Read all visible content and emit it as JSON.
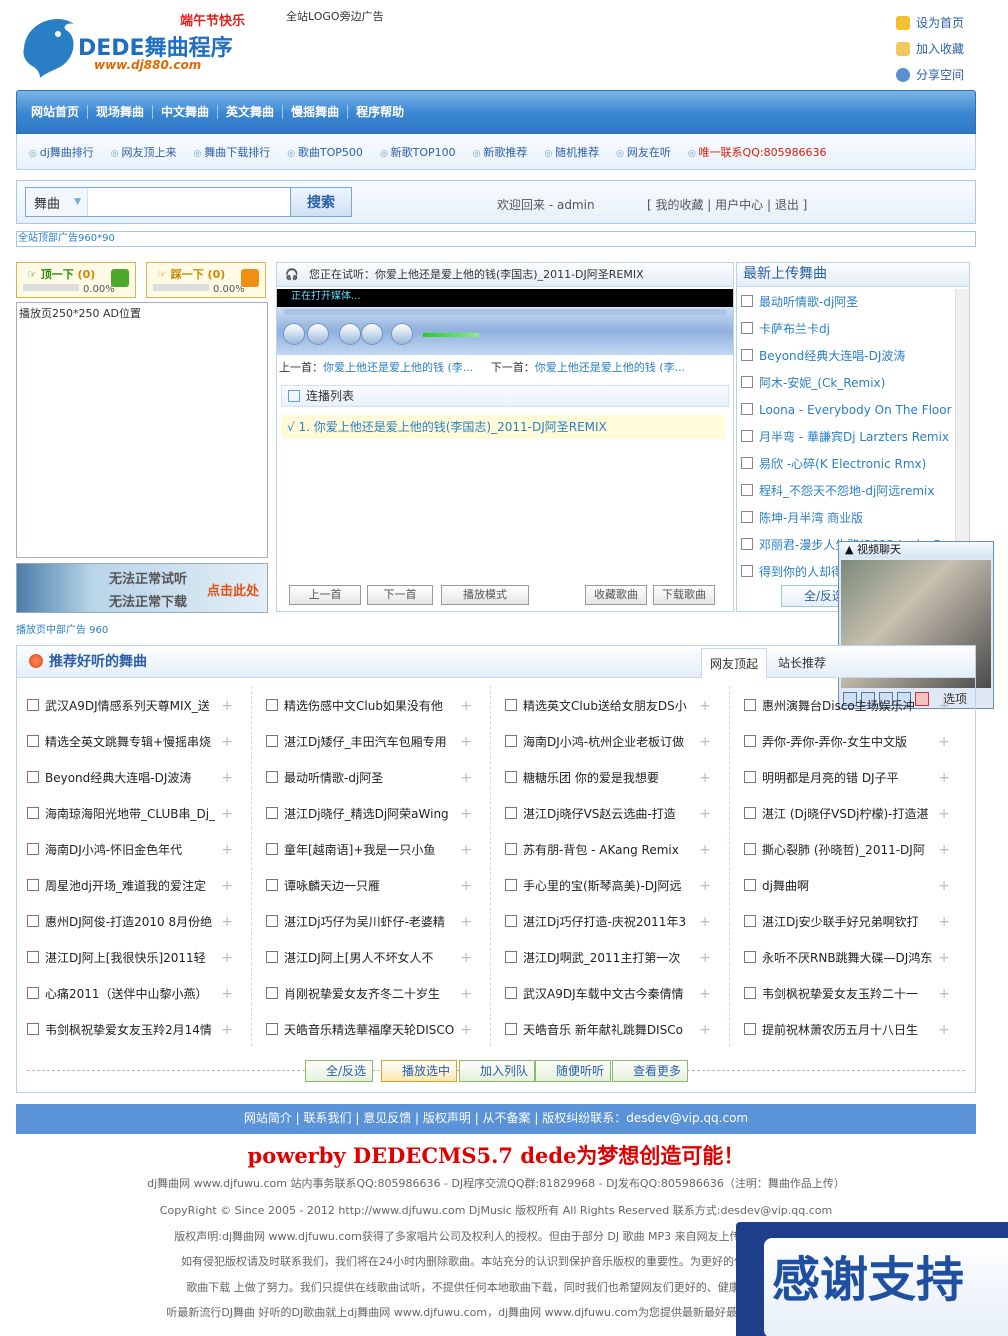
{
  "header": {
    "logo_brand": "DEDE舞曲程序",
    "logo_url": "www.dj880.com",
    "logo_slogan": "端午节快乐",
    "top_ad": "全站LOGO旁边广告",
    "links": [
      "设为首页",
      "加入收藏",
      "分享空间"
    ]
  },
  "nav": [
    "网站首页",
    "现场舞曲",
    "中文舞曲",
    "英文舞曲",
    "慢摇舞曲",
    "程序帮助"
  ],
  "subnav": [
    "dj舞曲排行",
    "网友顶上来",
    "舞曲下载排行",
    "歌曲TOP500",
    "新歌TOP100",
    "新歌推荐",
    "随机推荐",
    "网友在听",
    "唯一联系QQ:805986636"
  ],
  "search": {
    "category": "舞曲",
    "value": "",
    "button": "搜索",
    "welcome": "欢迎回来 - admin",
    "user_links": "[ 我的收藏 | 用户中心 | 退出 ]"
  },
  "top_ad_bar": "全站顶部广告960*90",
  "votes": {
    "up_label": "顶一下",
    "up_count": "(0)",
    "up_pct": "0.00%",
    "up_fraction": 0,
    "down_label": "踩一下",
    "down_count": "(0)",
    "down_pct": "0.00%",
    "down_fraction": 0
  },
  "left_ad": "播放页250*250 AD位置",
  "no_listen": {
    "line1": "无法正常试听",
    "line2": "无法正常下载",
    "cta": "点击此处"
  },
  "player": {
    "now_playing": "您正在试听：你爱上他还是爱上他的钱(李国志)_2011-DJ阿圣REMIX",
    "status": "正在打开媒体...",
    "prev_label": "上一首：",
    "prev_song": "你爱上他还是爱上他的钱 (李...",
    "next_label": "下一首：",
    "next_song": "你爱上他还是爱上他的钱 (李...",
    "playlist_title": "连播列表",
    "playlist": [
      "√ 1. 你爱上他还是爱上他的钱(李国志)_2011-DJ阿圣REMIX"
    ],
    "buttons": [
      "上一首",
      "下一首",
      "播放模式",
      "收藏歌曲",
      "下载歌曲"
    ]
  },
  "latest": {
    "title": "最新上传舞曲",
    "items": [
      "最动听情歌-dj阿圣",
      "卡萨布兰卡dj",
      "Beyond经典大连唱-DJ波涛",
      "阿木-安妮_(Ck_Remix)",
      "Loona - Everybody On The Floor",
      "月半弯 - 華謙宾Dj Larzters Remix",
      "易欣 -心碎(K Electronic Rmx)",
      "程科_不怨天不怨地-dj阿远remix",
      "陈坤-月半湾 商业版",
      "邓丽君-漫步人生路(2012 Jooks Remix)",
      "得到你的人却得不到你的心"
    ],
    "select_all": "全/反选"
  },
  "video_chat": {
    "title": "视频聊天",
    "option": "选项"
  },
  "mid_ad": "播放页中部广告 960",
  "recommend": {
    "title": "推荐好听的舞曲",
    "tabs": [
      "网友顶起",
      "站长推荐"
    ],
    "columns": [
      [
        "武汉A9DJ情感系列天尊MIX_送",
        "精选全英文跳舞专辑+慢摇串烧",
        "Beyond经典大连唱-DJ波涛",
        "海南琼海阳光地带_CLUB串_Dj_",
        "海南DJ小鸿-怀旧金色年代",
        "周星池dj开场_难道我的爱注定",
        "惠州DJ阿俊-打造2010 8月份绝",
        "湛江DJ阿上[我很快乐]2011轻",
        "心痛2011（送伴中山黎小燕）",
        "韦剑枫祝挚爱女友玉羚2月14情"
      ],
      [
        "精选伤感中文Club如果没有他",
        "湛江Dj矮仔_丰田汽车包厢专用",
        "最动听情歌-dj阿圣",
        "湛江Dj晓仔_精选Dj阿荣aWing",
        "童年[越南语]+我是一只小鱼",
        "谭咏麟天边一只雁",
        "湛江Dj巧仔为吴川虾仔-老婆精",
        "湛江DJ阿上[男人不坏女人不",
        "肖刚祝挚爱女友齐冬二十岁生",
        "天皓音乐精选華福摩天轮DISCO"
      ],
      [
        "精选英文Club送给女朋友DS小",
        "海南DJ小鸿-杭州企业老板订做",
        "糖糖乐团 你的爱是我想要",
        "湛江Dj晓仔VS赵云选曲-打造",
        "苏有朋-背包 - AKang Remix",
        "手心里的宝(斯琴高美)-DJ阿远",
        "湛江Dj巧仔打造-庆祝2011年3",
        "湛江DJ啊武_2011主打第一次",
        "武汉A9DJ车载中文古今秦倩情",
        "天皓音乐 新年献礼跳舞DISCo"
      ],
      [
        "惠州演舞台Disco主场娱乐冲",
        "弄你-弄你-弄你-女生中文版",
        "明明都是月亮的错 DJ子平",
        "湛江 (Dj晓仔VSDj柠檬)-打造湛",
        "撕心裂肺 (孙晓哲)_2011-DJ阿",
        "dj舞曲啊",
        "湛江Dj安少联手好兄弟啊钦打",
        "永听不厌RNB跳舞大碟—DJ鸿东",
        "韦剑枫祝挚爱女友玉羚二十一",
        "提前祝林萧农历五月十八日生"
      ]
    ],
    "buttons": [
      "全/反选",
      "播放选中",
      "加入列队",
      "随便听听",
      "查看更多"
    ]
  },
  "footer": {
    "links": "网站简介 | 联系我们 | 意见反馈 | 版权声明 | 从不备案 | 版权纠纷联系：desdev@vip.qq.com",
    "powered": "powerby DEDECMS5.7 dede为梦想创造可能！",
    "line1": "dj舞曲网 www.djfuwu.com 站内事务联系QQ:805986636 - DJ程序交流QQ群:81829968 - DJ发布QQ:805986636（注明：舞曲作品上传）",
    "line2": "CopyRight © Since 2005 - 2012 http://www.djfuwu.com DjMusic 版权所有 All Rights Reserved 联系方式:desdev@vip.qq.com",
    "para": [
      "版权声明:dj舞曲网 www.djfuwu.com获得了多家唱片公司及权利人的授权。但由于部分 DJ 歌曲 MP3 来自网友上传和搜索引擎，无",
      "如有侵犯版权请及时联系我们，我们将在24小时内删除歌曲。本站充分的认识到保护音乐版权的重要性。为更好的保护歌曲著作人",
      "歌曲下载 上做了努力。我们只提供在线歌曲试听，不提供任何本地歌曲下载，同时我们也希望网友们更好的、健康的认识到尊重",
      "听最新流行DJ舞曲 好听的DJ歌曲就上dj舞曲网 www.djfuwu.com，dj舞曲网 www.djfuwu.com为您提供最新最好最全最经典的DJ舞曲"
    ]
  },
  "thanks_banner": "感谢支持",
  "colors": {
    "brand_blue": "#3a86d3",
    "link": "#2a7fc4",
    "red": "#d81e06",
    "footer_bar": "#5b93d9"
  }
}
